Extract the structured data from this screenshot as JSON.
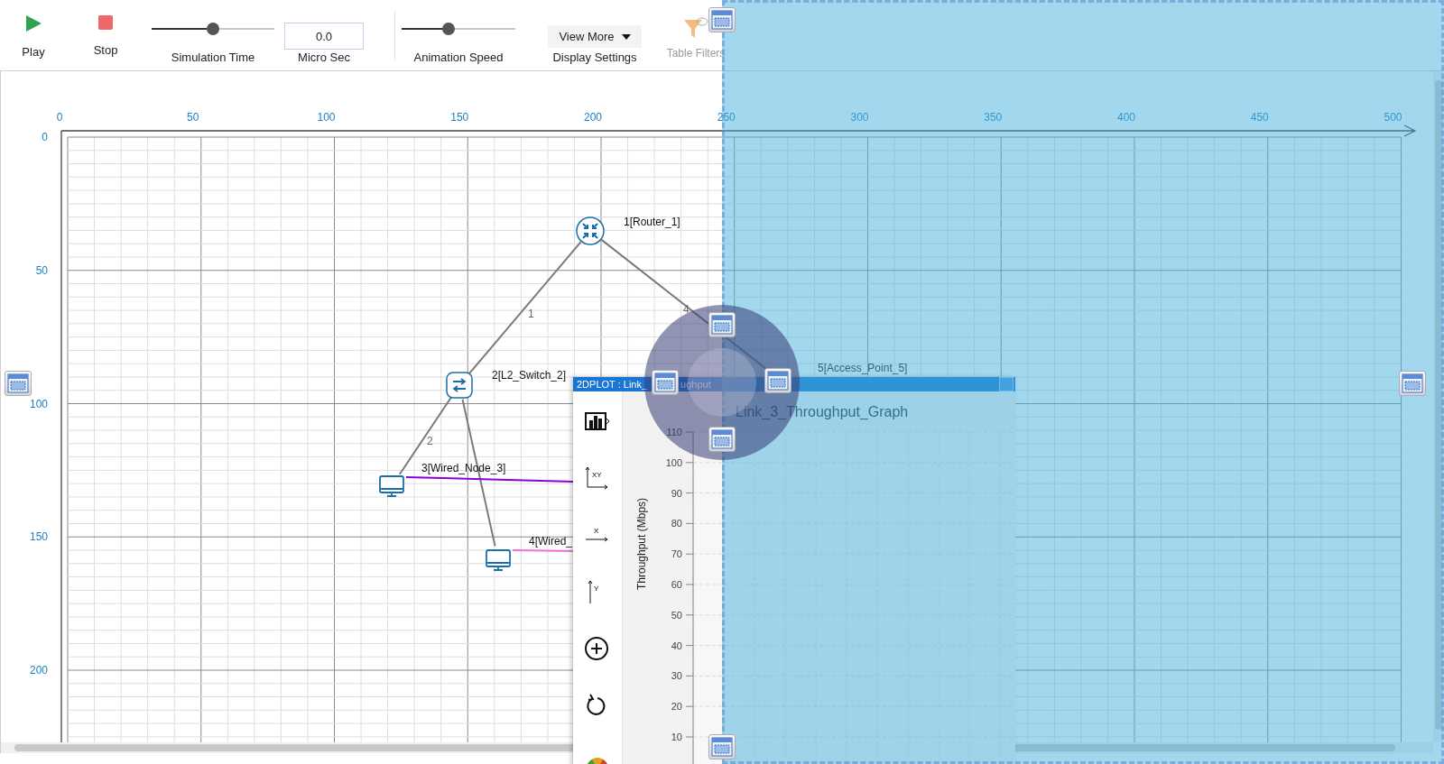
{
  "toolbar": {
    "play": {
      "label": "Play"
    },
    "stop": {
      "label": "Stop"
    },
    "simulation_time": {
      "label": "Simulation Time",
      "level": 0.5
    },
    "time_field": {
      "value": "0.0",
      "label": "Micro Sec"
    },
    "animation_speed": {
      "label": "Animation Speed",
      "level": 0.41
    },
    "display_settings": {
      "button": "View More",
      "label": "Display Settings"
    },
    "table_filters": {
      "label": "Table Filters",
      "disabled": true
    }
  },
  "canvas": {
    "x_ticks": [
      "0",
      "50",
      "100",
      "150",
      "200",
      "250",
      "300",
      "350",
      "400",
      "450",
      "500"
    ],
    "y_ticks": [
      "0",
      "50",
      "100",
      "150",
      "200"
    ],
    "nodes": [
      {
        "kind": "router",
        "label": "1[Router_1]"
      },
      {
        "kind": "switch",
        "label": "2[L2_Switch_2]"
      },
      {
        "kind": "computer",
        "label": "3[Wired_Node_3]"
      },
      {
        "kind": "computer",
        "label": "4[Wired_"
      },
      {
        "kind": "access_point",
        "label": "5[Access_Point_5]"
      }
    ],
    "links": [
      {
        "kind": "wired",
        "label": "1"
      },
      {
        "kind": "wired",
        "label": "2"
      },
      {
        "kind": "wired"
      },
      {
        "kind": "wired",
        "label": "4"
      },
      {
        "kind": "wireless",
        "color": "#8a00e0"
      },
      {
        "kind": "wireless",
        "color": "#f070e0"
      }
    ]
  },
  "plot_window": {
    "title_parts": [
      "2DPLOT : Link_",
      "ughput"
    ],
    "tools": [
      {
        "kind": "add_plot"
      },
      {
        "kind": "xy_axis",
        "label": "XY"
      },
      {
        "kind": "x_axis",
        "label": "X"
      },
      {
        "kind": "y_axis",
        "label": "Y"
      },
      {
        "kind": "zoom_in"
      },
      {
        "kind": "reset"
      },
      {
        "kind": "gauge"
      }
    ],
    "chart": {
      "title": "Link_3_Throughput_Graph",
      "y_title": "Throughput (Mbps)",
      "y_ticks": [
        "110",
        "100",
        "90",
        "80",
        "70",
        "60",
        "50",
        "40",
        "30",
        "20",
        "10"
      ]
    }
  }
}
